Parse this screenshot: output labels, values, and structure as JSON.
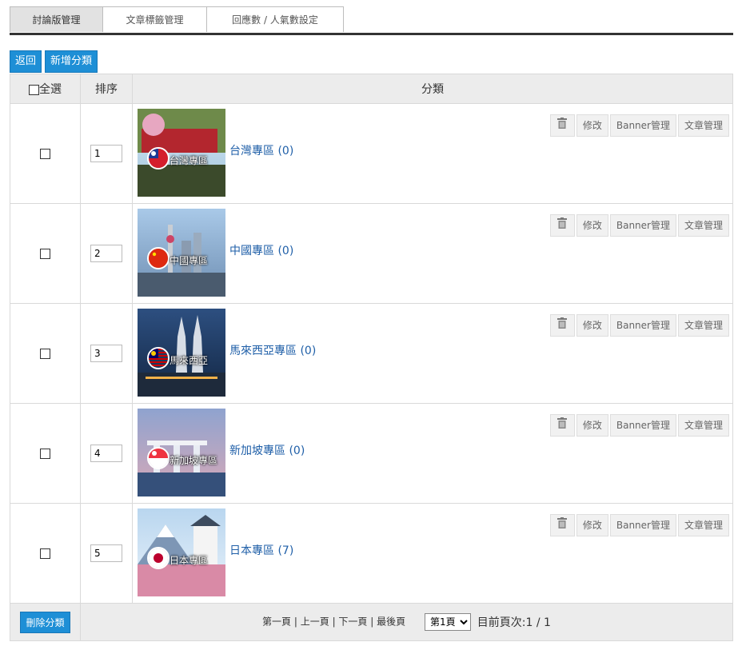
{
  "tabs": [
    {
      "label": "討論版管理",
      "active": true
    },
    {
      "label": "文章標籤管理",
      "active": false
    },
    {
      "label": "回應數 / 人氣數設定",
      "active": false
    }
  ],
  "buttons": {
    "back": "返回",
    "add_category": "新增分類",
    "delete_category": "刪除分類"
  },
  "table": {
    "header": {
      "select_all": "全選",
      "order": "排序",
      "category": "分類"
    },
    "rows": [
      {
        "order": "1",
        "thumb_label": "台灣專區",
        "name": "台灣專區 (0)",
        "flag": "taiwan-flag-icon"
      },
      {
        "order": "2",
        "thumb_label": "中國專區",
        "name": "中國專區 (0)",
        "flag": "china-flag-icon"
      },
      {
        "order": "3",
        "thumb_label": "馬來西亞",
        "name": "馬來西亞專區 (0)",
        "flag": "malaysia-flag-icon"
      },
      {
        "order": "4",
        "thumb_label": "新加坡專區",
        "name": "新加坡專區 (0)",
        "flag": "singapore-flag-icon"
      },
      {
        "order": "5",
        "thumb_label": "日本專區",
        "name": "日本專區 (7)",
        "flag": "japan-flag-icon"
      }
    ],
    "actions": {
      "delete_icon": "trash-icon",
      "edit": "修改",
      "banner": "Banner管理",
      "articles": "文章管理"
    }
  },
  "pagination": {
    "first": "第一頁",
    "prev": "上一頁",
    "next": "下一頁",
    "last": "最後頁",
    "selected_page": "第1頁",
    "current_label": "目前頁次:1 / 1"
  },
  "colors": {
    "accent": "#1e8fd6",
    "link": "#1f5fa8",
    "tab_active_bg": "#e2e2e2"
  }
}
